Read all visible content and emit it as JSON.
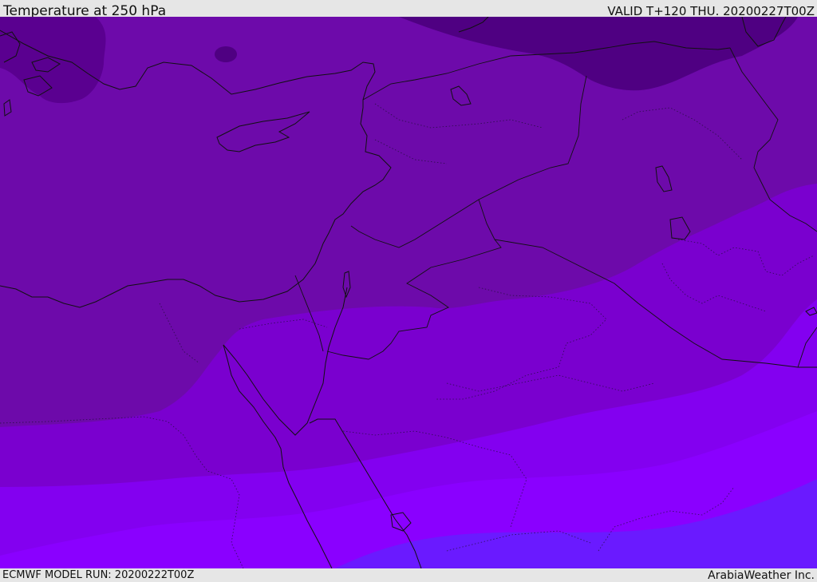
{
  "header": {
    "title": "Temperature at 250 hPa",
    "valid": "VALID T+120 THU. 20200227T00Z"
  },
  "footer": {
    "model_run": "ECMWF MODEL RUN: 20200222T00Z",
    "credit": "ArabiaWeather Inc."
  },
  "map": {
    "field": "temperature",
    "level_hpa": 250,
    "palette": [
      "#4f0082",
      "#5f0094",
      "#6d0aaa",
      "#7a00cf",
      "#8300f0",
      "#8a00ff",
      "#6a1aff"
    ],
    "lines": {
      "coastline": "#111111",
      "borders": "#111111"
    }
  }
}
